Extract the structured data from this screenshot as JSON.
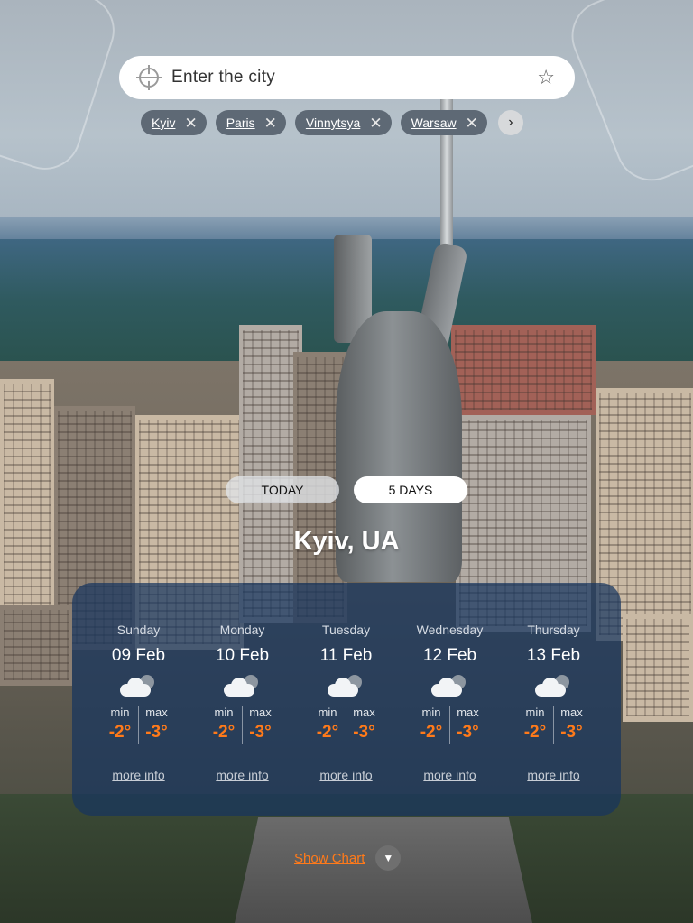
{
  "search": {
    "placeholder": "Enter the city",
    "location_icon": "crosshair-icon",
    "favorite_icon": "star-icon"
  },
  "recent_cities": [
    {
      "label": "Kyiv"
    },
    {
      "label": "Paris"
    },
    {
      "label": "Vinnytsya"
    },
    {
      "label": "Warsaw"
    }
  ],
  "chips_next_glyph": "›",
  "chip_remove_glyph": "✕",
  "view_toggle": {
    "today_label": "TODAY",
    "days_label": "5 DAYS",
    "selected": "5 DAYS"
  },
  "location_title": "Kyiv, UA",
  "forecast": [
    {
      "day": "Sunday",
      "date": "09 Feb",
      "icon": "partly-cloudy-icon",
      "min_label": "min",
      "max_label": "max",
      "min": "-2",
      "max": "-3",
      "unit": "°",
      "more": "more info"
    },
    {
      "day": "Monday",
      "date": "10 Feb",
      "icon": "partly-cloudy-icon",
      "min_label": "min",
      "max_label": "max",
      "min": "-2",
      "max": "-3",
      "unit": "°",
      "more": "more info"
    },
    {
      "day": "Tuesday",
      "date": "11 Feb",
      "icon": "partly-cloudy-icon",
      "min_label": "min",
      "max_label": "max",
      "min": "-2",
      "max": "-3",
      "unit": "°",
      "more": "more info"
    },
    {
      "day": "Wednesday",
      "date": "12 Feb",
      "icon": "partly-cloudy-icon",
      "min_label": "min",
      "max_label": "max",
      "min": "-2",
      "max": "-3",
      "unit": "°",
      "more": "more info"
    },
    {
      "day": "Thursday",
      "date": "13 Feb",
      "icon": "partly-cloudy-icon",
      "min_label": "min",
      "max_label": "max",
      "min": "-2",
      "max": "-3",
      "unit": "°",
      "more": "more info"
    }
  ],
  "show_chart": {
    "label": "Show Chart",
    "icon": "chevron-down-icon"
  },
  "colors": {
    "accent": "#ff7a1a",
    "panel": "#16345e"
  }
}
